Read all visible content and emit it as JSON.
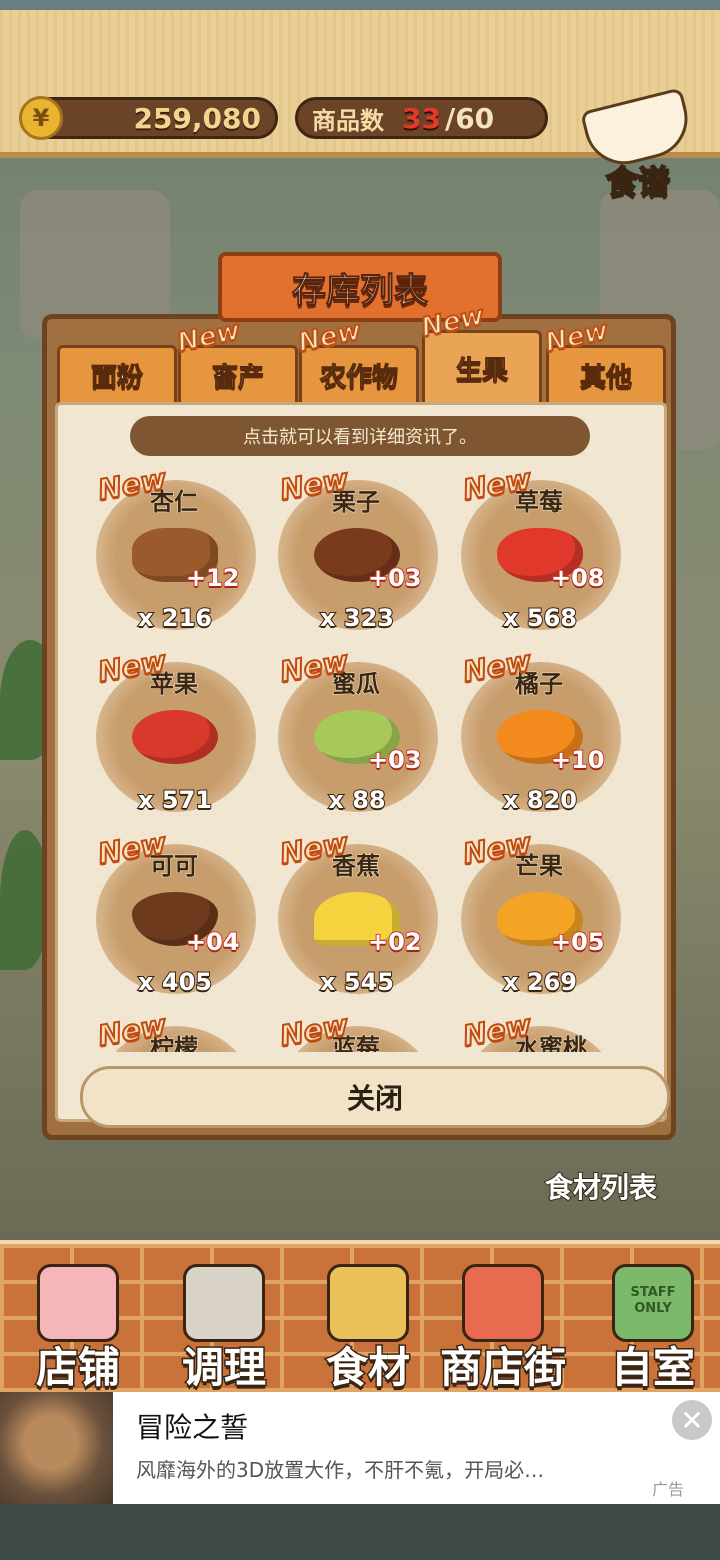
{
  "topbar": {
    "coin_icon_glyph": "¥",
    "coins": "259,080",
    "goods_label": "商品数",
    "goods_current": "33",
    "goods_max": "/60",
    "recipe_label": "食谱"
  },
  "dialog": {
    "title": "存库列表",
    "hint": "点击就可以看到详细资讯了。",
    "close_label": "关闭",
    "new_badge": "New",
    "tabs": [
      {
        "label": "面粉",
        "new": false,
        "active": false
      },
      {
        "label": "畜产",
        "new": true,
        "active": false
      },
      {
        "label": "农作物",
        "new": true,
        "active": false
      },
      {
        "label": "生果",
        "new": true,
        "active": true
      },
      {
        "label": "其他",
        "new": true,
        "active": false
      }
    ],
    "items": [
      {
        "name": "杏仁",
        "bonus": "+12",
        "count": "x 216",
        "icon": "almond-icon"
      },
      {
        "name": "栗子",
        "bonus": "+03",
        "count": "x 323",
        "icon": "chestnut-icon"
      },
      {
        "name": "草莓",
        "bonus": "+08",
        "count": "x 568",
        "icon": "strawberry-icon"
      },
      {
        "name": "苹果",
        "bonus": "",
        "count": "x 571",
        "icon": "apple-icon"
      },
      {
        "name": "蜜瓜",
        "bonus": "+03",
        "count": "x 88",
        "icon": "melon-icon"
      },
      {
        "name": "橘子",
        "bonus": "+10",
        "count": "x 820",
        "icon": "orange-icon"
      },
      {
        "name": "可可",
        "bonus": "+04",
        "count": "x 405",
        "icon": "cocoa-icon"
      },
      {
        "name": "香蕉",
        "bonus": "+02",
        "count": "x 545",
        "icon": "banana-icon"
      },
      {
        "name": "芒果",
        "bonus": "+05",
        "count": "x 269",
        "icon": "mango-icon"
      },
      {
        "name": "柠檬",
        "bonus": "",
        "count": "",
        "icon": "lemon-icon"
      },
      {
        "name": "蓝莓",
        "bonus": "",
        "count": "",
        "icon": "blueberry-icon"
      },
      {
        "name": "水蜜桃",
        "bonus": "",
        "count": "",
        "icon": "peach-icon"
      }
    ]
  },
  "ingredient_list_label": "食材列表",
  "bottom_nav": [
    {
      "label": "店铺",
      "icon": "cake-icon"
    },
    {
      "label": "调理",
      "icon": "mixing-bowl-icon"
    },
    {
      "label": "食材",
      "icon": "flour-sack-icon"
    },
    {
      "label": "商店街",
      "icon": "storefront-icon"
    },
    {
      "label": "自室",
      "icon": "staff-only-sign-icon"
    }
  ],
  "staff_sign_text": "STAFF ONLY",
  "ad": {
    "title": "冒险之誓",
    "description": "风靡海外的3D放置大作，不肝不氪，开局必…",
    "label": "广告",
    "close_glyph": "✕"
  },
  "colors": {
    "tab_orange": "#e6963f",
    "panel_cream": "#f1e6d2",
    "coin_gold": "#e9b530",
    "goods_red": "#e23a2a",
    "bonus_red": "#d23b2b"
  }
}
